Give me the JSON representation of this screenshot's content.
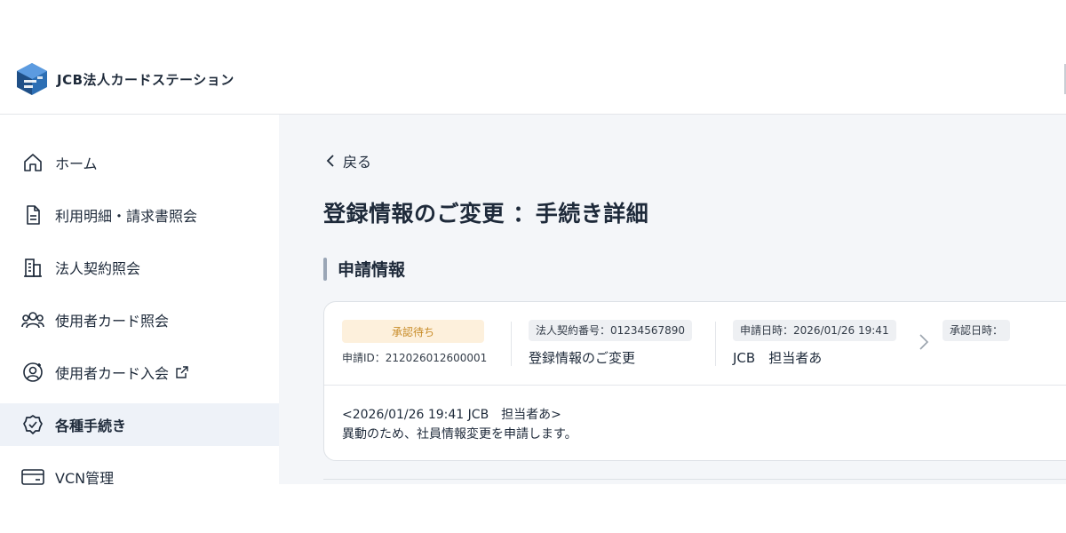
{
  "brand": {
    "name": "JCB法人カードステーション"
  },
  "sidebar": {
    "items": [
      {
        "label": "ホーム",
        "icon": "home-icon"
      },
      {
        "label": "利用明細・請求書照会",
        "icon": "document-icon"
      },
      {
        "label": "法人契約照会",
        "icon": "building-icon"
      },
      {
        "label": "使用者カード照会",
        "icon": "users-icon"
      },
      {
        "label": "使用者カード入会",
        "icon": "user-add-icon",
        "external": true
      },
      {
        "label": "各種手続き",
        "icon": "check-badge-icon",
        "active": true
      },
      {
        "label": "VCN管理",
        "icon": "card-icon"
      }
    ]
  },
  "main": {
    "back_label": "戻る",
    "title": "登録情報のご変更 ：手続き詳細",
    "section_title": "申請情報",
    "card": {
      "status": "承認待ち",
      "application_id_label": "申請ID：",
      "application_id": "212026012600001",
      "contract_label": "法人契約番号：",
      "contract_number": "01234567890",
      "procedure_name": "登録情報のご変更",
      "applied_at_label": "申請日時：",
      "applied_at": "2026/01/26 19:41",
      "applicant": "JCB　担当者あ",
      "approved_at_label": "承認日時：",
      "comment_header": "<2026/01/26 19:41 JCB　担当者あ>",
      "comment_body": "異動のため、社員情報変更を申請します。"
    }
  },
  "colors": {
    "accent": "#1e2a3a",
    "active_bg": "#eef2f8",
    "status_bg": "#fdf0dc",
    "status_text": "#c78a25",
    "logo_blue": "#2d6fb4"
  }
}
